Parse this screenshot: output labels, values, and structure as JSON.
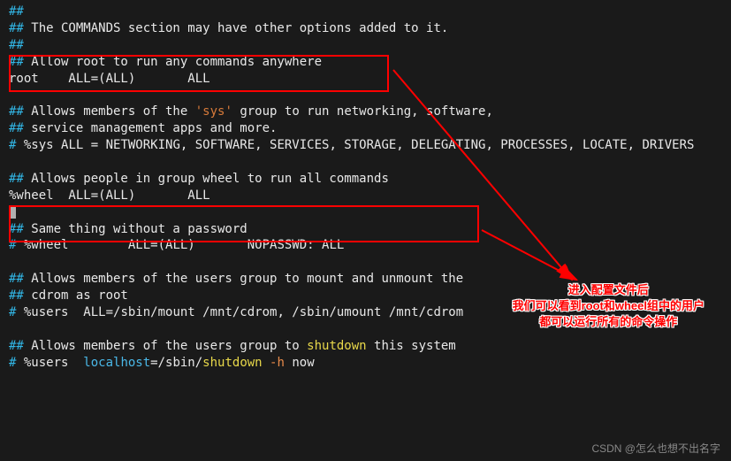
{
  "lines": {
    "l1": "##",
    "l2a": "##",
    "l2b": " The COMMANDS section may have other options added to it.",
    "l3": "##",
    "l4a": "##",
    "l4b": " Allow root to run any commands anywhere",
    "l5": "root    ALL=(ALL)       ALL",
    "l6": " ",
    "l7a": "##",
    "l7b": " Allows members of the ",
    "l7c": "'sys'",
    "l7d": " group to run networking, software,",
    "l8a": "##",
    "l8b": " service management apps and more.",
    "l9a": "#",
    "l9b": " %sys ALL = NETWORKING, SOFTWARE, SERVICES, STORAGE, DELEGATING, PROCESSES, LOCATE, DRIVERS",
    "l10": " ",
    "l11a": "##",
    "l11b": " Allows people in group wheel to run all commands",
    "l12": "%wheel  ALL=(ALL)       ALL",
    "l13": " ",
    "l14a": "##",
    "l14b": " Same thing without a password",
    "l15a": "#",
    "l15b": " %wheel        ALL=(ALL)       NOPASSWD: ALL",
    "l16": " ",
    "l17a": "##",
    "l17b": " Allows members of the users group to mount and unmount the",
    "l18a": "##",
    "l18b": " cdrom as root",
    "l19a": "#",
    "l19b": " %users  ALL=/sbin/mount /mnt/cdrom, /sbin/umount /mnt/cdrom",
    "l20": " ",
    "l21a": "##",
    "l21b": " Allows members of the users group to ",
    "l21c": "shutdown",
    "l21d": " this system",
    "l22a": "#",
    "l22b": " %users  ",
    "l22c": "localhost",
    "l22d": "=/sbin/",
    "l22e": "shutdown",
    "l22f": " -h",
    "l22g": " now"
  },
  "annotation": {
    "line1": "进入配置文件后",
    "line2": "我们可以看到root和wheel组中的用户",
    "line3": "都可以运行所有的命令操作"
  },
  "watermark": "CSDN @怎么也想不出名字"
}
